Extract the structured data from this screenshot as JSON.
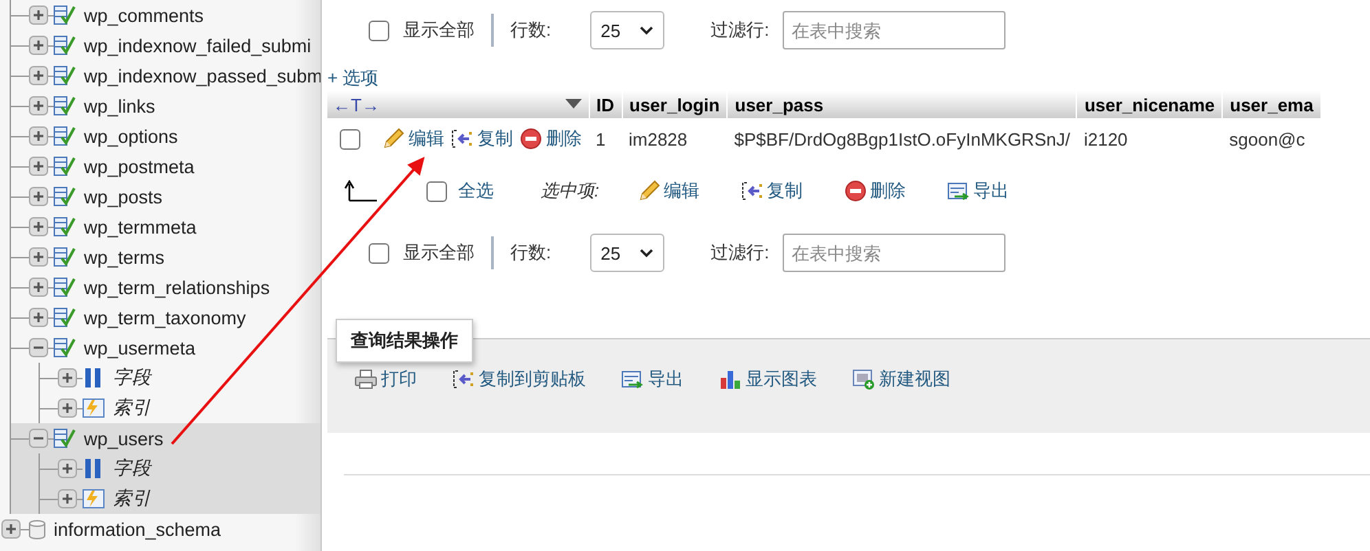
{
  "sidebar": {
    "tables": [
      {
        "label": "wp_comments",
        "expanded": false,
        "selected": false
      },
      {
        "label": "wp_indexnow_failed_submi",
        "expanded": false,
        "selected": false
      },
      {
        "label": "wp_indexnow_passed_subm",
        "expanded": false,
        "selected": false
      },
      {
        "label": "wp_links",
        "expanded": false,
        "selected": false
      },
      {
        "label": "wp_options",
        "expanded": false,
        "selected": false
      },
      {
        "label": "wp_postmeta",
        "expanded": false,
        "selected": false
      },
      {
        "label": "wp_posts",
        "expanded": false,
        "selected": false
      },
      {
        "label": "wp_termmeta",
        "expanded": false,
        "selected": false
      },
      {
        "label": "wp_terms",
        "expanded": false,
        "selected": false
      },
      {
        "label": "wp_term_relationships",
        "expanded": false,
        "selected": false
      },
      {
        "label": "wp_term_taxonomy",
        "expanded": false,
        "selected": false
      },
      {
        "label": "wp_usermeta",
        "expanded": true,
        "selected": false,
        "children": [
          {
            "label": "字段",
            "kind": "columns",
            "expanded": false
          },
          {
            "label": "索引",
            "kind": "indexes",
            "expanded": false
          }
        ]
      },
      {
        "label": "wp_users",
        "expanded": true,
        "selected": true,
        "children": [
          {
            "label": "字段",
            "kind": "columns",
            "expanded": false
          },
          {
            "label": "索引",
            "kind": "indexes",
            "expanded": false
          }
        ]
      }
    ],
    "databases": [
      {
        "label": "information_schema",
        "expanded": false
      }
    ]
  },
  "navigation": [
    {
      "show_all": {
        "label": "显示全部",
        "checked": false
      },
      "rows_label": "行数:",
      "rows_value": "25",
      "filter_label": "过滤行:",
      "filter": {
        "placeholder": "在表中搜索"
      }
    },
    {
      "show_all": {
        "label": "显示全部",
        "checked": false
      },
      "rows_label": "行数:",
      "rows_value": "25",
      "filter_label": "过滤行:",
      "filter": {
        "placeholder": "在表中搜索"
      }
    }
  ],
  "options_link": "+ 选项",
  "table": {
    "header_tools": "←T→",
    "columns": [
      "ID",
      "user_login",
      "user_pass",
      "user_nicename",
      "user_ema"
    ],
    "rows": [
      {
        "checked": false,
        "actions": [
          {
            "kind": "edit",
            "label": "编辑"
          },
          {
            "kind": "copy",
            "label": "复制"
          },
          {
            "kind": "delete",
            "label": "删除"
          }
        ],
        "cells": [
          "1",
          "im2828",
          "$P$BF/DrdOg8Bgp1IstO.oFyInMKGRSnJ/",
          "i2120",
          "sgoon@c"
        ]
      }
    ]
  },
  "with_selected": {
    "select_all": {
      "label": "全选",
      "checked": false
    },
    "label": "选中项:",
    "actions": [
      {
        "kind": "edit",
        "label": "编辑"
      },
      {
        "kind": "copy",
        "label": "复制"
      },
      {
        "kind": "delete",
        "label": "删除"
      },
      {
        "kind": "export",
        "label": "导出"
      }
    ]
  },
  "query_results": {
    "legend": "查询结果操作",
    "actions": [
      {
        "kind": "print",
        "label": "打印"
      },
      {
        "kind": "copy",
        "label": "复制到剪贴板"
      },
      {
        "kind": "export",
        "label": "导出"
      },
      {
        "kind": "chart",
        "label": "显示图表"
      },
      {
        "kind": "view",
        "label": "新建视图"
      }
    ]
  }
}
